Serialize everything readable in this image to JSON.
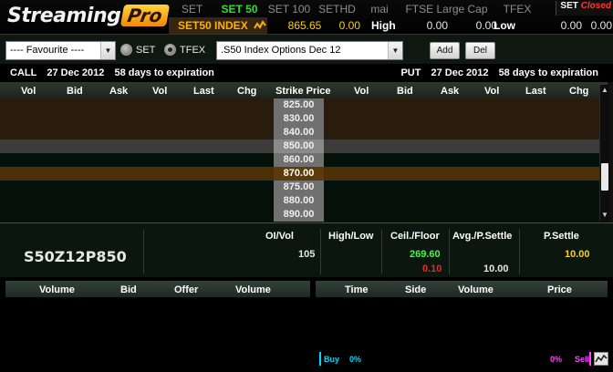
{
  "logo": {
    "text": "Streaming",
    "badge": "Pro"
  },
  "markets": {
    "tabs": [
      "SET",
      "SET 50",
      "SET 100",
      "SETHD",
      "mai",
      "FTSE Large Cap",
      "TFEX"
    ],
    "status_label": "SET",
    "status_value": "Closed"
  },
  "index_bar": {
    "name": "SET50 INDEX",
    "last": "865.65",
    "change": "0.00",
    "high_label": "High",
    "high_1": "0.00",
    "high_2": "0.00",
    "low_label": "Low",
    "low_1": "0.00",
    "low_2": "0.00"
  },
  "toolbar": {
    "favourite": "---- Favourite ----",
    "radio_set": "SET",
    "radio_tfex": "TFEX",
    "series": ".S50 Index Options Dec 12",
    "add_label": "Add",
    "del_label": "Del"
  },
  "expiry": {
    "call_label": "CALL",
    "call_date": "27 Dec 2012",
    "call_days": "58 days to expiration",
    "put_label": "PUT",
    "put_date": "27 Dec 2012",
    "put_days": "58 days to expiration"
  },
  "chain_header": [
    "Vol",
    "Bid",
    "Ask",
    "Vol",
    "Last",
    "Chg",
    "Strike Price",
    "Vol",
    "Bid",
    "Ask",
    "Vol",
    "Last",
    "Chg"
  ],
  "strikes": [
    "825.00",
    "830.00",
    "840.00",
    "850.00",
    "860.00",
    "870.00",
    "875.00",
    "880.00",
    "890.00"
  ],
  "detail": {
    "symbol": "S50Z12P850",
    "oi_vol_label": "OI/Vol",
    "oi_vol": "105",
    "high_low_label": "High/Low",
    "ceil_floor_label": "Ceil./Floor",
    "ceil": "269.60",
    "floor": "0.10",
    "avg_settle_label": "Avg./P.Settle",
    "avg_settle": "10.00",
    "p_settle_label": "P.Settle",
    "p_settle": "10.00"
  },
  "bidoffer_header": [
    "Volume",
    "Bid",
    "Offer",
    "Volume"
  ],
  "ticker_header": [
    "Time",
    "Side",
    "Volume",
    "Price"
  ],
  "buy_sell": {
    "buy_label": "Buy",
    "buy_pct": "0%",
    "sell_pct": "0%",
    "sell_label": "Sell"
  },
  "colors": {
    "accent_green": "#27e027",
    "index_orange": "#ffb000",
    "price_yellow": "#ffd200",
    "up_green": "#3cff3c",
    "down_red": "#ff2020"
  }
}
